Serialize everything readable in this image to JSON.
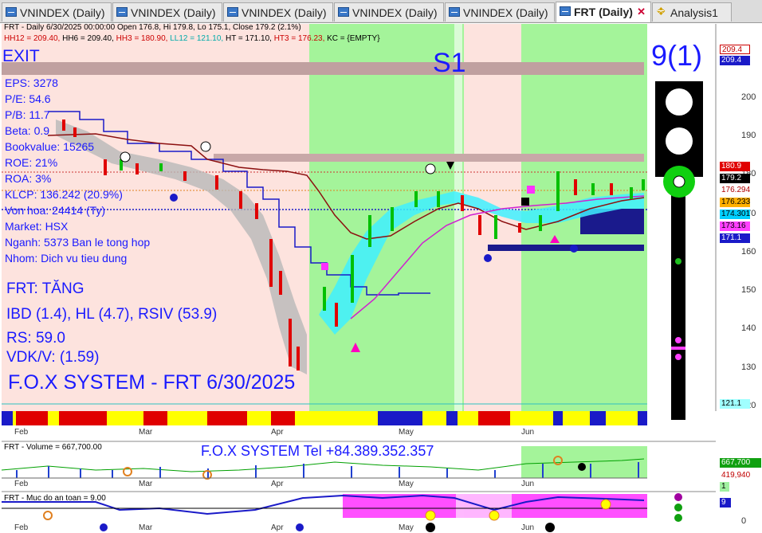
{
  "tabs": [
    {
      "label": "VNINDEX (Daily)",
      "active": false
    },
    {
      "label": "VNINDEX (Daily)",
      "active": false
    },
    {
      "label": "VNINDEX (Daily)",
      "active": false
    },
    {
      "label": "VNINDEX (Daily)",
      "active": false
    },
    {
      "label": "VNINDEX (Daily)",
      "active": false
    },
    {
      "label": "FRT (Daily)",
      "active": true
    },
    {
      "label": "Analysis1",
      "active": false
    }
  ],
  "header": {
    "line1": "FRT - Daily 6/30/2025 00:00:00 Open 176.8, Hi 179.8, Lo 175.1, Close 179.2 (2.1%)",
    "hh12": "HH12 = 209.40,",
    "hh6": "HH6 = 209.40,",
    "hh3": "HH3 = 180.90,",
    "ll12": "LL12 = 121.10,",
    "ht": "HT = 171.10,",
    "ht3": "HT3 = 176.23,",
    "kc": "KC = {EMPTY}"
  },
  "signals": {
    "exit": "EXIT",
    "s1": "S1",
    "score": "9(1)"
  },
  "fundamentals": [
    "EPS: 3278",
    "P/E: 54.6",
    "P/B: 11.7",
    "Beta: 0.9",
    "Bookvalue: 15265",
    "ROE: 21%",
    "ROA: 3%",
    "KLCP: 136.242 (20.9%)",
    "Von hoa: 24414 (Ty)",
    "Market: HSX",
    "Nganh: 5373 Ban le tong hop",
    "Nhom: Dich vu tieu dung"
  ],
  "analysis": [
    "FRT: TĂNG",
    "IBD (1.4), HL (4.7), RSIV (53.9)",
    "RS: 59.0",
    "VDK/V:  (1.59)"
  ],
  "footer_title": "F.O.X SYSTEM - FRT 6/30/2025",
  "contact": "F.O.X SYSTEM Tel +84.389.352.357",
  "price_axis": [
    "200",
    "190",
    "180",
    "170",
    "160",
    "150",
    "140",
    "130",
    "120"
  ],
  "price_tags": [
    {
      "text": "209.4",
      "bg": "#ffffff",
      "fg": "#c00000"
    },
    {
      "text": "209.4",
      "bg": "#1a1ac8",
      "fg": "#ffffff"
    },
    {
      "text": "180.9",
      "bg": "#e00000",
      "fg": "#ffffff"
    },
    {
      "text": "179.2",
      "bg": "#000000",
      "fg": "#ffffff"
    },
    {
      "text": "176.294",
      "bg": "#ffffff",
      "fg": "#b00000"
    },
    {
      "text": "176.233",
      "bg": "#ffb000",
      "fg": "#000000"
    },
    {
      "text": "174.301",
      "bg": "#00d0ff",
      "fg": "#000000"
    },
    {
      "text": "173.16",
      "bg": "#ff40ff",
      "fg": "#000000"
    },
    {
      "text": "171.1",
      "bg": "#1a1ac8",
      "fg": "#ffffff"
    },
    {
      "text": "121.1",
      "bg": "#a0ffff",
      "fg": "#000000"
    }
  ],
  "months": [
    "Feb",
    "Mar",
    "Apr",
    "May",
    "Jun"
  ],
  "volume": {
    "header": "FRT - Volume = 667,700.00",
    "tag_current": "667,700",
    "tag_avg": "419,940",
    "tag_small": "1"
  },
  "safety": {
    "header": "FRT - Muc do an toan = 9.00",
    "tag": "9",
    "axis_zero": "0"
  },
  "colors": {
    "accent": "#1a1aff",
    "bull": "#00c000",
    "bear": "#e00000",
    "zone_green": "#a0f090",
    "zone_pink": "#fde0dc"
  }
}
